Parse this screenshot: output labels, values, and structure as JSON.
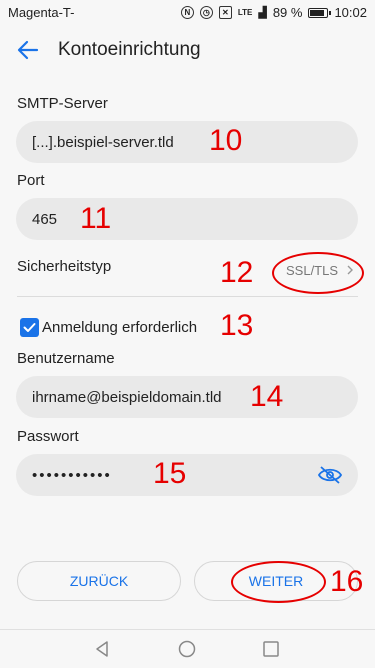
{
  "status_bar": {
    "carrier": "Magenta-T-",
    "battery": "89 %",
    "time": "10:02",
    "network": "LTE"
  },
  "app_bar": {
    "title": "Kontoeinrichtung",
    "back_icon": "arrow-left-icon"
  },
  "form": {
    "smtp_label": "SMTP-Server",
    "smtp_value": "[...].beispiel-server.tld",
    "port_label": "Port",
    "port_value": "465",
    "security_label": "Sicherheitstyp",
    "security_value": "SSL/TLS",
    "auth_label": "Anmeldung erforderlich",
    "auth_checked": true,
    "username_label": "Benutzername",
    "username_value": "ihrname@beispieldomain.tld",
    "password_label": "Passwort",
    "password_value": "•••••••••••"
  },
  "annotations": [
    "10",
    "11",
    "12",
    "13",
    "14",
    "15",
    "16"
  ],
  "buttons": {
    "back": "ZURÜCK",
    "next": "WEITER"
  },
  "colors": {
    "accent": "#1a73e8",
    "annotation": "#e60000",
    "field_bg": "#e9e9e9"
  }
}
